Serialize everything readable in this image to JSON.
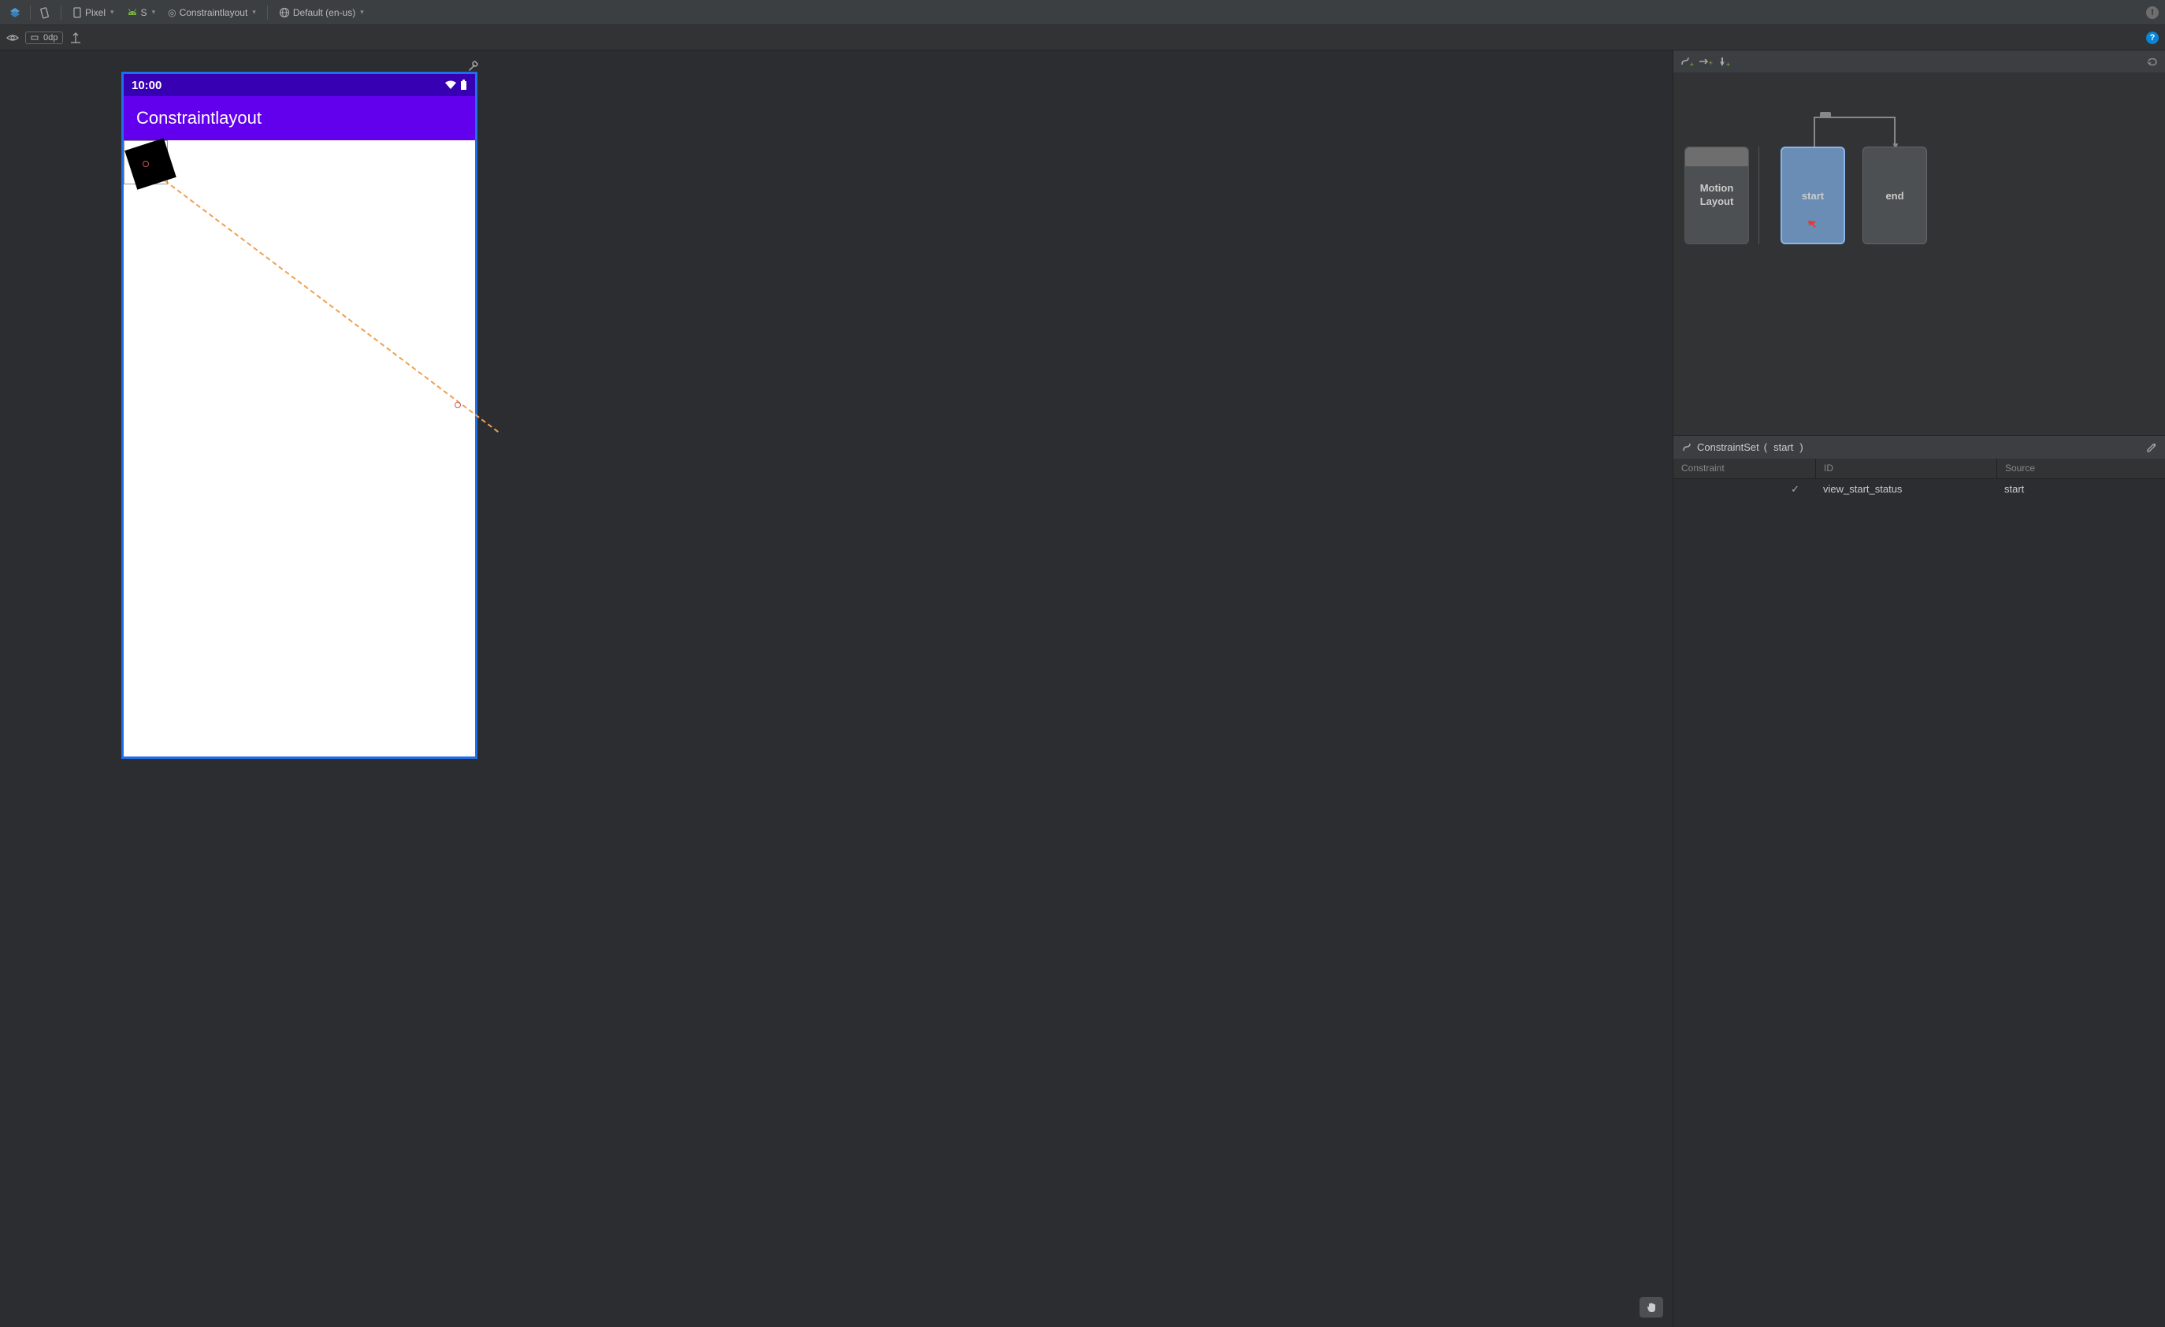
{
  "toolbar1": {
    "device": "Pixel",
    "api": "S",
    "layout": "Constraintlayout",
    "locale": "Default (en-us)"
  },
  "toolbar2": {
    "margin": "0dp"
  },
  "phone": {
    "time": "10:00",
    "appTitle": "Constraintlayout"
  },
  "motion": {
    "motionLayoutLabel1": "Motion",
    "motionLayoutLabel2": "Layout",
    "startLabel": "start",
    "endLabel": "end"
  },
  "constraintSet": {
    "headerPrefix": "ConstraintSet",
    "headerValue": "start",
    "col1": "Constraint",
    "col2": "ID",
    "col3": "Source",
    "row": {
      "check": "✓",
      "id": "view_start_status",
      "source": "start"
    }
  }
}
